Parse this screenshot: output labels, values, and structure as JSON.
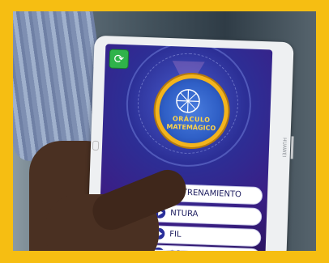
{
  "colors": {
    "border": "#f6be12",
    "screen_bg": "#2c2f96",
    "logo_ring": "#f3b41c",
    "refresh_button": "#2fb34a",
    "menu_button_bg": "#ffffff",
    "menu_text": "#1b1b5e"
  },
  "app": {
    "logo_line1": "ORÁCULO",
    "logo_line2": "MATEMÁGICO",
    "refresh_icon": "refresh-icon"
  },
  "menu": [
    {
      "label": "ENTRENAMIENTO",
      "icon": "play-icon"
    },
    {
      "label": "NTURA",
      "icon": "play-icon"
    },
    {
      "label": "FIL",
      "icon": "play-icon"
    },
    {
      "label": "OS",
      "icon": "play-icon"
    }
  ],
  "device": {
    "brand": "HUAWEI"
  }
}
